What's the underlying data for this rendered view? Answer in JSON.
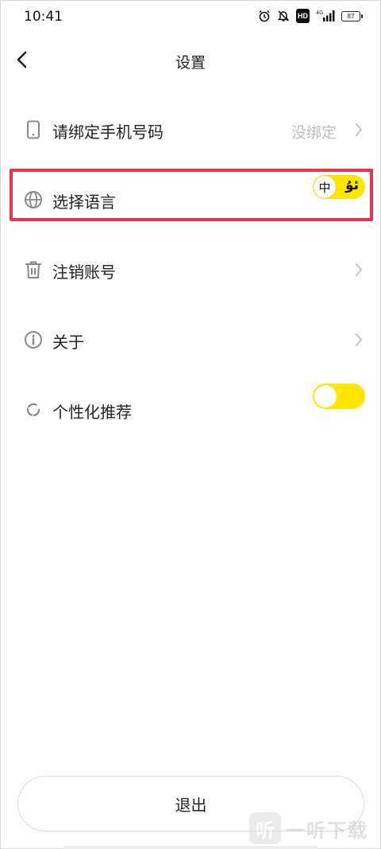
{
  "status_bar": {
    "time": "10:41",
    "network": "4G",
    "hd_label": "HD",
    "battery": "87",
    "icons": [
      "alarm-icon",
      "bell-off-icon",
      "hd-icon",
      "signal-icon",
      "battery-icon"
    ]
  },
  "header": {
    "title": "设置",
    "back_icon": "chevron-left-icon"
  },
  "rows": [
    {
      "id": "bind-phone",
      "icon": "phone-icon",
      "label": "请绑定手机号码",
      "value": "没绑定",
      "chevron": true
    },
    {
      "id": "language",
      "icon": "globe-icon",
      "label": "选择语言",
      "switch": {
        "selected": "中",
        "alternate": "ئۇ"
      }
    },
    {
      "id": "delete-account",
      "icon": "trash-icon",
      "label": "注销账号",
      "chevron": true
    },
    {
      "id": "about",
      "icon": "info-icon",
      "label": "关于",
      "chevron": true
    },
    {
      "id": "personalized",
      "icon": "refresh-icon",
      "label": "个性化推荐",
      "toggle_on": true
    }
  ],
  "logout": {
    "label": "退出"
  },
  "watermark": {
    "badge": "听",
    "text": "一听下载"
  },
  "colors": {
    "accent": "#ffe500",
    "highlight_border": "#e8344e",
    "muted_text": "#bdbdbd",
    "icon_gray": "#888888"
  }
}
